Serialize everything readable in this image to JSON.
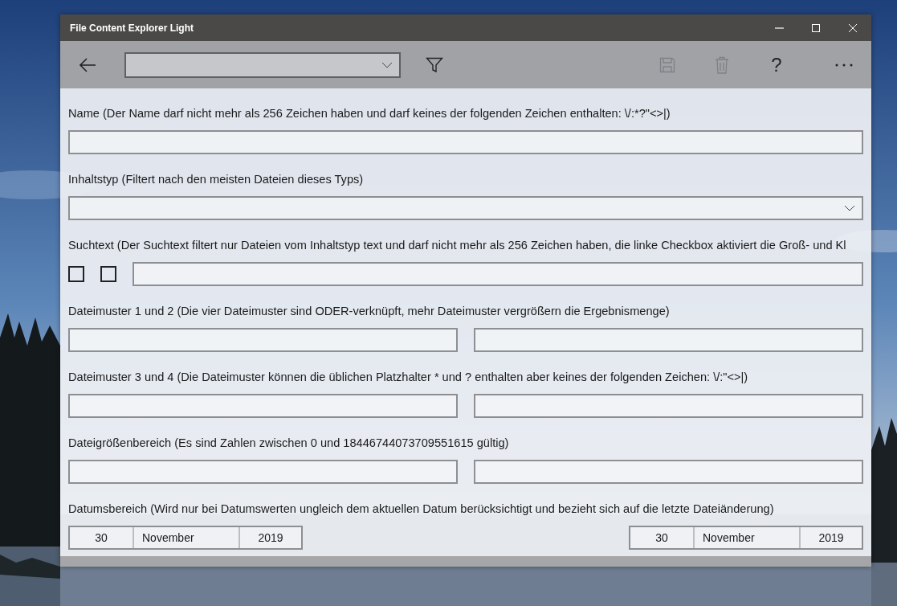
{
  "window": {
    "title": "File Content Explorer Light"
  },
  "toolbar": {
    "save": {
      "disabled": true
    },
    "delete": {
      "disabled": true
    },
    "help": "?"
  },
  "sections": [
    {
      "kind": "text",
      "label": "Name (Der Name darf nicht mehr als 256 Zeichen haben und darf keines der folgenden Zeichen enthalten: \\/:*?\"<>|)"
    },
    {
      "kind": "dropdown",
      "label": "Inhaltstyp (Filtert nach den meisten Dateien dieses Typs)"
    },
    {
      "kind": "search",
      "label": "Suchtext (Der Suchtext filtert nur Dateien vom Inhaltstyp text und darf nicht mehr als 256 Zeichen haben, die linke Checkbox aktiviert die Groß- und Kl",
      "checkboxes": [
        {
          "checked": false
        },
        {
          "checked": false
        }
      ]
    },
    {
      "kind": "pair",
      "label": "Dateimuster 1 und 2 (Die vier Dateimuster sind ODER-verknüpft, mehr Dateimuster vergrößern die Ergebnismenge)"
    },
    {
      "kind": "pair",
      "label": "Dateimuster 3 und 4 (Die Dateimuster können die üblichen Platzhalter * und ? enthalten aber keines der folgenden Zeichen: \\/:\"<>|)"
    },
    {
      "kind": "pair",
      "label": "Dateigrößenbereich (Es sind Zahlen zwischen 0 und 18446744073709551615 gültig)"
    },
    {
      "kind": "dates",
      "label": "Datumsbereich (Wird nur bei Datumswerten ungleich dem aktuellen Datum berücksichtigt und bezieht sich auf die letzte Dateiänderung)",
      "dates": [
        {
          "day": "30",
          "month": "November",
          "year": "2019"
        },
        {
          "day": "30",
          "month": "November",
          "year": "2019"
        }
      ]
    }
  ]
}
